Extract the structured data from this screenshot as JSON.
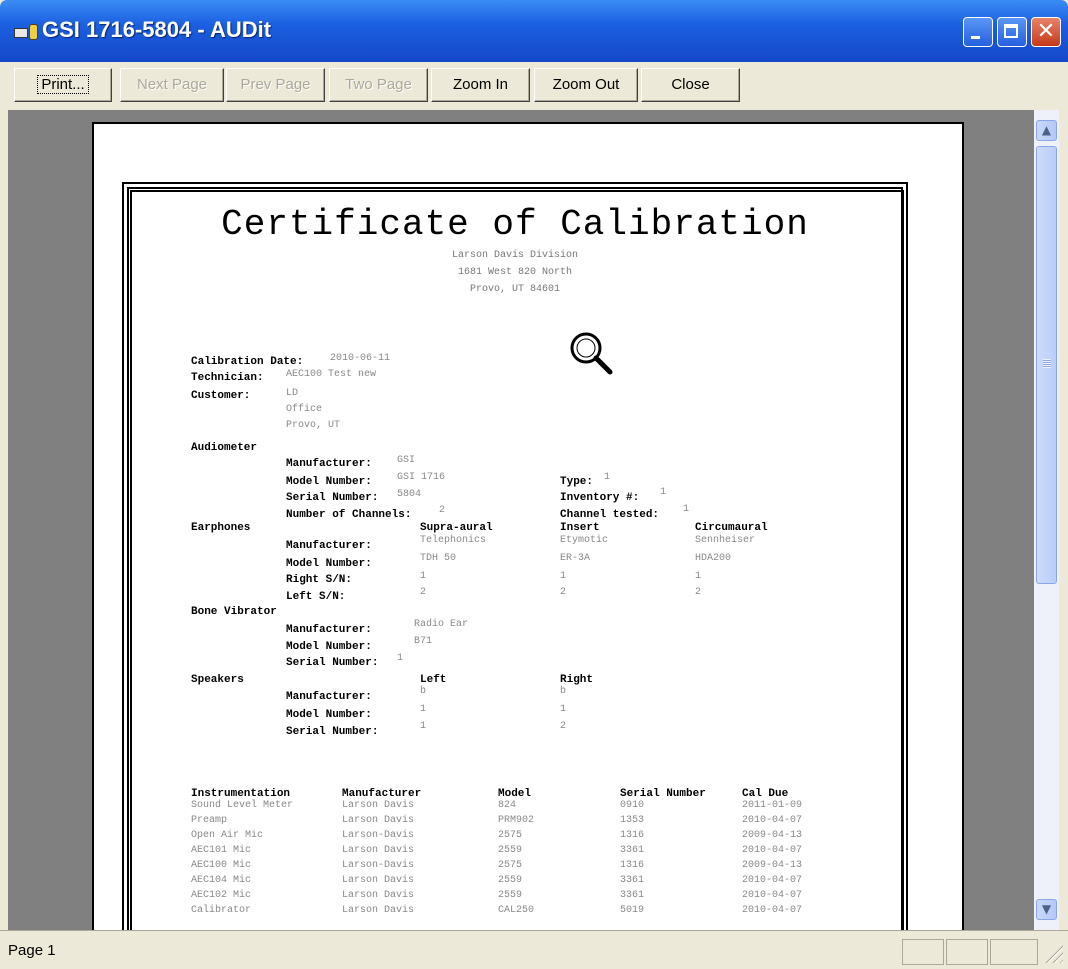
{
  "window": {
    "title": "GSI 1716-5804 - AUDit"
  },
  "toolbar": {
    "print": "Print...",
    "next_page": "Next Page",
    "prev_page": "Prev Page",
    "two_page": "Two Page",
    "zoom_in": "Zoom In",
    "zoom_out": "Zoom Out",
    "close": "Close"
  },
  "certificate": {
    "title": "Certificate of Calibration",
    "org": "Larson Davis Division",
    "street": "1681 West 820 North",
    "city": "Provo, UT  84601",
    "calibration_date_label": "Calibration Date:",
    "calibration_date": "2010-06-11",
    "technician_label": "Technician:",
    "technician": "AEC100 Test new",
    "customer_label": "Customer:",
    "customer_lines": [
      "LD",
      "Office",
      "Provo, UT"
    ],
    "audiometer": {
      "heading": "Audiometer",
      "manufacturer_label": "Manufacturer:",
      "manufacturer": "GSI",
      "model_label": "Model Number:",
      "model": "GSI 1716",
      "serial_label": "Serial Number:",
      "serial": "5804",
      "channels_label": "Number of Channels:",
      "channels": "2",
      "type_label": "Type:",
      "type": "1",
      "inventory_label": "Inventory #:",
      "inventory": "1",
      "channel_tested_label": "Channel tested:",
      "channel_tested": "1"
    },
    "earphones": {
      "heading": "Earphones",
      "columns": [
        "Supra-aural",
        "Insert",
        "Circumaural"
      ],
      "manufacturer_label": "Manufacturer:",
      "model_label": "Model Number:",
      "right_label": "Right S/N:",
      "left_label": "Left S/N:",
      "manufacturers": [
        "Telephonics",
        "Etymotic",
        "Sennheiser"
      ],
      "models": [
        "TDH 50",
        "ER-3A",
        "HDA200"
      ],
      "right_sn": [
        "1",
        "1",
        "1"
      ],
      "left_sn": [
        "2",
        "2",
        "2"
      ]
    },
    "bone": {
      "heading": "Bone Vibrator",
      "manufacturer_label": "Manufacturer:",
      "manufacturer": "Radio Ear",
      "model_label": "Model Number:",
      "model": "B71",
      "serial_label": "Serial Number:",
      "serial": "1"
    },
    "speakers": {
      "heading": "Speakers",
      "columns": [
        "Left",
        "Right"
      ],
      "manufacturer_label": "Manufacturer:",
      "model_label": "Model Number:",
      "serial_label": "Serial Number:",
      "manufacturers": [
        "b",
        "b"
      ],
      "models": [
        "1",
        "1"
      ],
      "serials": [
        "1",
        "2"
      ]
    },
    "instrumentation": {
      "headers": [
        "Instrumentation",
        "Manufacturer",
        "Model",
        "Serial Number",
        "Cal Due"
      ],
      "rows": [
        [
          "Sound Level Meter",
          "Larson Davis",
          "824",
          "0910",
          "2011-01-09"
        ],
        [
          "Preamp",
          "Larson Davis",
          "PRM902",
          "1353",
          "2010-04-07"
        ],
        [
          "Open Air Mic",
          "Larson-Davis",
          "2575",
          "1316",
          "2009-04-13"
        ],
        [
          "AEC101 Mic",
          "Larson Davis",
          "2559",
          "3361",
          "2010-04-07"
        ],
        [
          "AEC100 Mic",
          "Larson-Davis",
          "2575",
          "1316",
          "2009-04-13"
        ],
        [
          "AEC104 Mic",
          "Larson Davis",
          "2559",
          "3361",
          "2010-04-07"
        ],
        [
          "AEC102 Mic",
          "Larson Davis",
          "2559",
          "3361",
          "2010-04-07"
        ],
        [
          "Calibrator",
          "Larson Davis",
          "CAL250",
          "5019",
          "2010-04-07"
        ]
      ]
    }
  },
  "status": {
    "page": "Page 1"
  }
}
